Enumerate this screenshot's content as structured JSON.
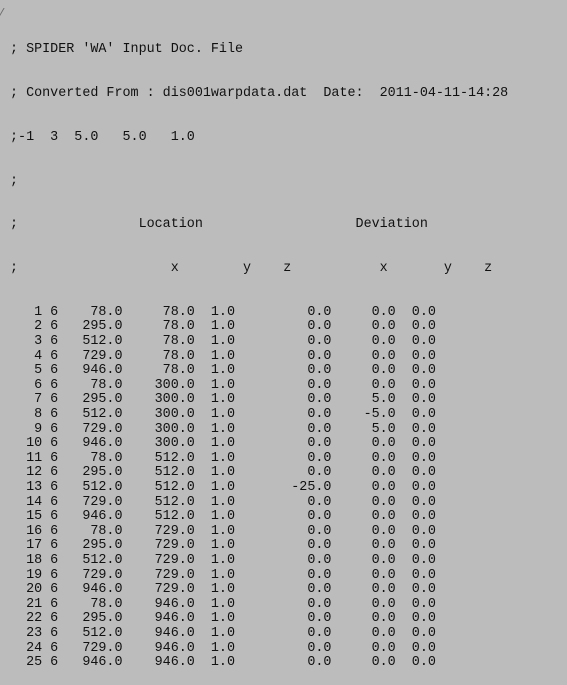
{
  "header": {
    "line1": "; SPIDER 'WA' Input Doc. File",
    "line2": "; Converted From : dis001warpdata.dat  Date:  2011-04-11-14:28",
    "line3": ";-1  3  5.0   5.0   1.0",
    "line4": ";",
    "line5": ";               Location                   Deviation",
    "line6": ";                   x        y    z           x       y    z"
  },
  "rows": [
    "   1 6    78.0     78.0  1.0         0.0     0.0  0.0",
    "   2 6   295.0     78.0  1.0         0.0     0.0  0.0",
    "   3 6   512.0     78.0  1.0         0.0     0.0  0.0",
    "   4 6   729.0     78.0  1.0         0.0     0.0  0.0",
    "   5 6   946.0     78.0  1.0         0.0     0.0  0.0",
    "   6 6    78.0    300.0  1.0         0.0     0.0  0.0",
    "   7 6   295.0    300.0  1.0         0.0     5.0  0.0",
    "   8 6   512.0    300.0  1.0         0.0    -5.0  0.0",
    "   9 6   729.0    300.0  1.0         0.0     5.0  0.0",
    "  10 6   946.0    300.0  1.0         0.0     0.0  0.0",
    "  11 6    78.0    512.0  1.0         0.0     0.0  0.0",
    "  12 6   295.0    512.0  1.0         0.0     0.0  0.0",
    "  13 6   512.0    512.0  1.0       -25.0     0.0  0.0",
    "  14 6   729.0    512.0  1.0         0.0     0.0  0.0",
    "  15 6   946.0    512.0  1.0         0.0     0.0  0.0",
    "  16 6    78.0    729.0  1.0         0.0     0.0  0.0",
    "  17 6   295.0    729.0  1.0         0.0     0.0  0.0",
    "  18 6   512.0    729.0  1.0         0.0     0.0  0.0",
    "  19 6   729.0    729.0  1.0         0.0     0.0  0.0",
    "  20 6   946.0    729.0  1.0         0.0     0.0  0.0",
    "  21 6    78.0    946.0  1.0         0.0     0.0  0.0",
    "  22 6   295.0    946.0  1.0         0.0     0.0  0.0",
    "  23 6   512.0    946.0  1.0         0.0     0.0  0.0",
    "  24 6   729.0    946.0  1.0         0.0     0.0  0.0",
    "  25 6   946.0    946.0  1.0         0.0     0.0  0.0"
  ]
}
